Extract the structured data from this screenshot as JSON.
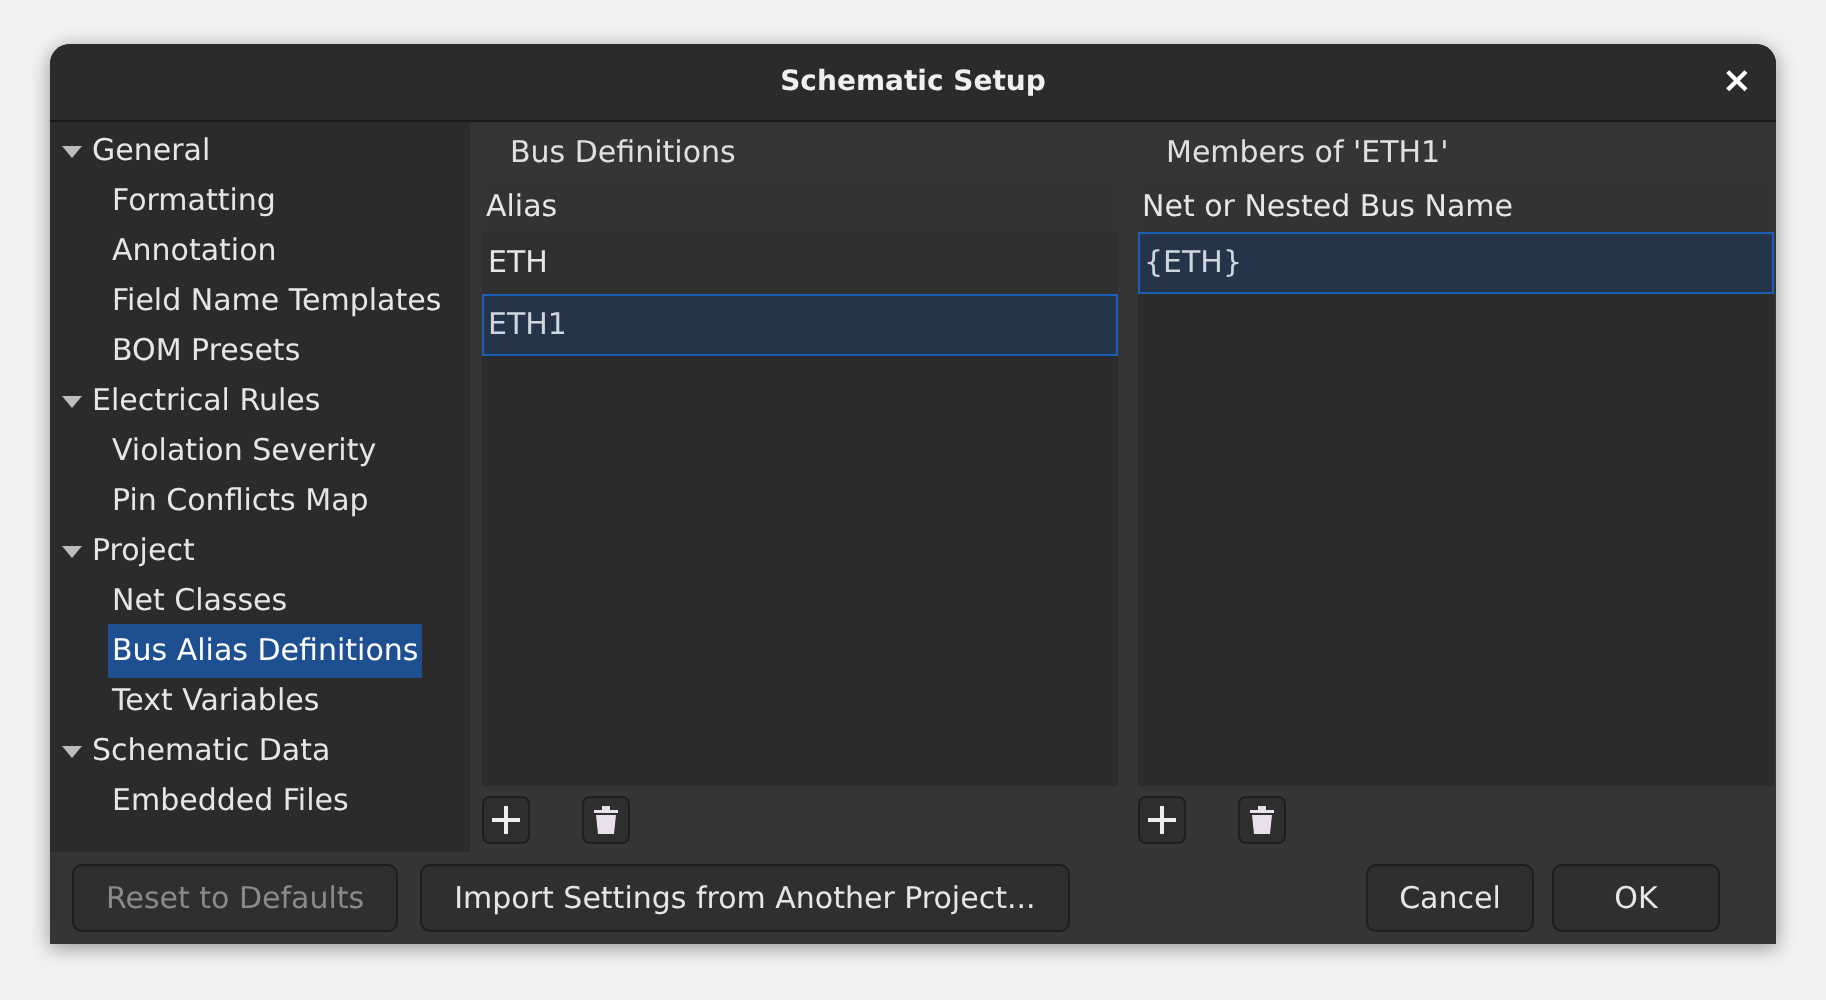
{
  "window": {
    "title": "Schematic Setup",
    "close": "×"
  },
  "sidebar": {
    "items": [
      {
        "label": "General",
        "expanded": true,
        "selected": false,
        "children": [
          {
            "label": "Formatting",
            "selected": false
          },
          {
            "label": "Annotation",
            "selected": false
          },
          {
            "label": "Field Name Templates",
            "selected": false
          },
          {
            "label": "BOM Presets",
            "selected": false
          }
        ]
      },
      {
        "label": "Electrical Rules",
        "expanded": true,
        "selected": false,
        "children": [
          {
            "label": "Violation Severity",
            "selected": false
          },
          {
            "label": "Pin Conflicts Map",
            "selected": false
          }
        ]
      },
      {
        "label": "Project",
        "expanded": true,
        "selected": false,
        "children": [
          {
            "label": "Net Classes",
            "selected": false
          },
          {
            "label": "Bus Alias Definitions",
            "selected": true
          },
          {
            "label": "Text Variables",
            "selected": false
          }
        ]
      },
      {
        "label": "Schematic Data",
        "expanded": true,
        "selected": false,
        "children": [
          {
            "label": "Embedded Files",
            "selected": false
          }
        ]
      }
    ]
  },
  "panels": [
    {
      "title": "Bus Definitions",
      "column": "Alias",
      "rows": [
        {
          "value": "ETH",
          "selected": false
        },
        {
          "value": "ETH1",
          "selected": true
        }
      ]
    },
    {
      "title": "Members of 'ETH1'",
      "column": "Net or Nested Bus Name",
      "rows": [
        {
          "value": "{ETH}",
          "selected": true
        }
      ]
    }
  ],
  "footer": {
    "buttons": [
      {
        "label": "Reset to Defaults",
        "disabled": true
      },
      {
        "label": "Import Settings from Another Project...",
        "disabled": false
      }
    ],
    "actions": [
      "Cancel",
      "OK"
    ]
  }
}
